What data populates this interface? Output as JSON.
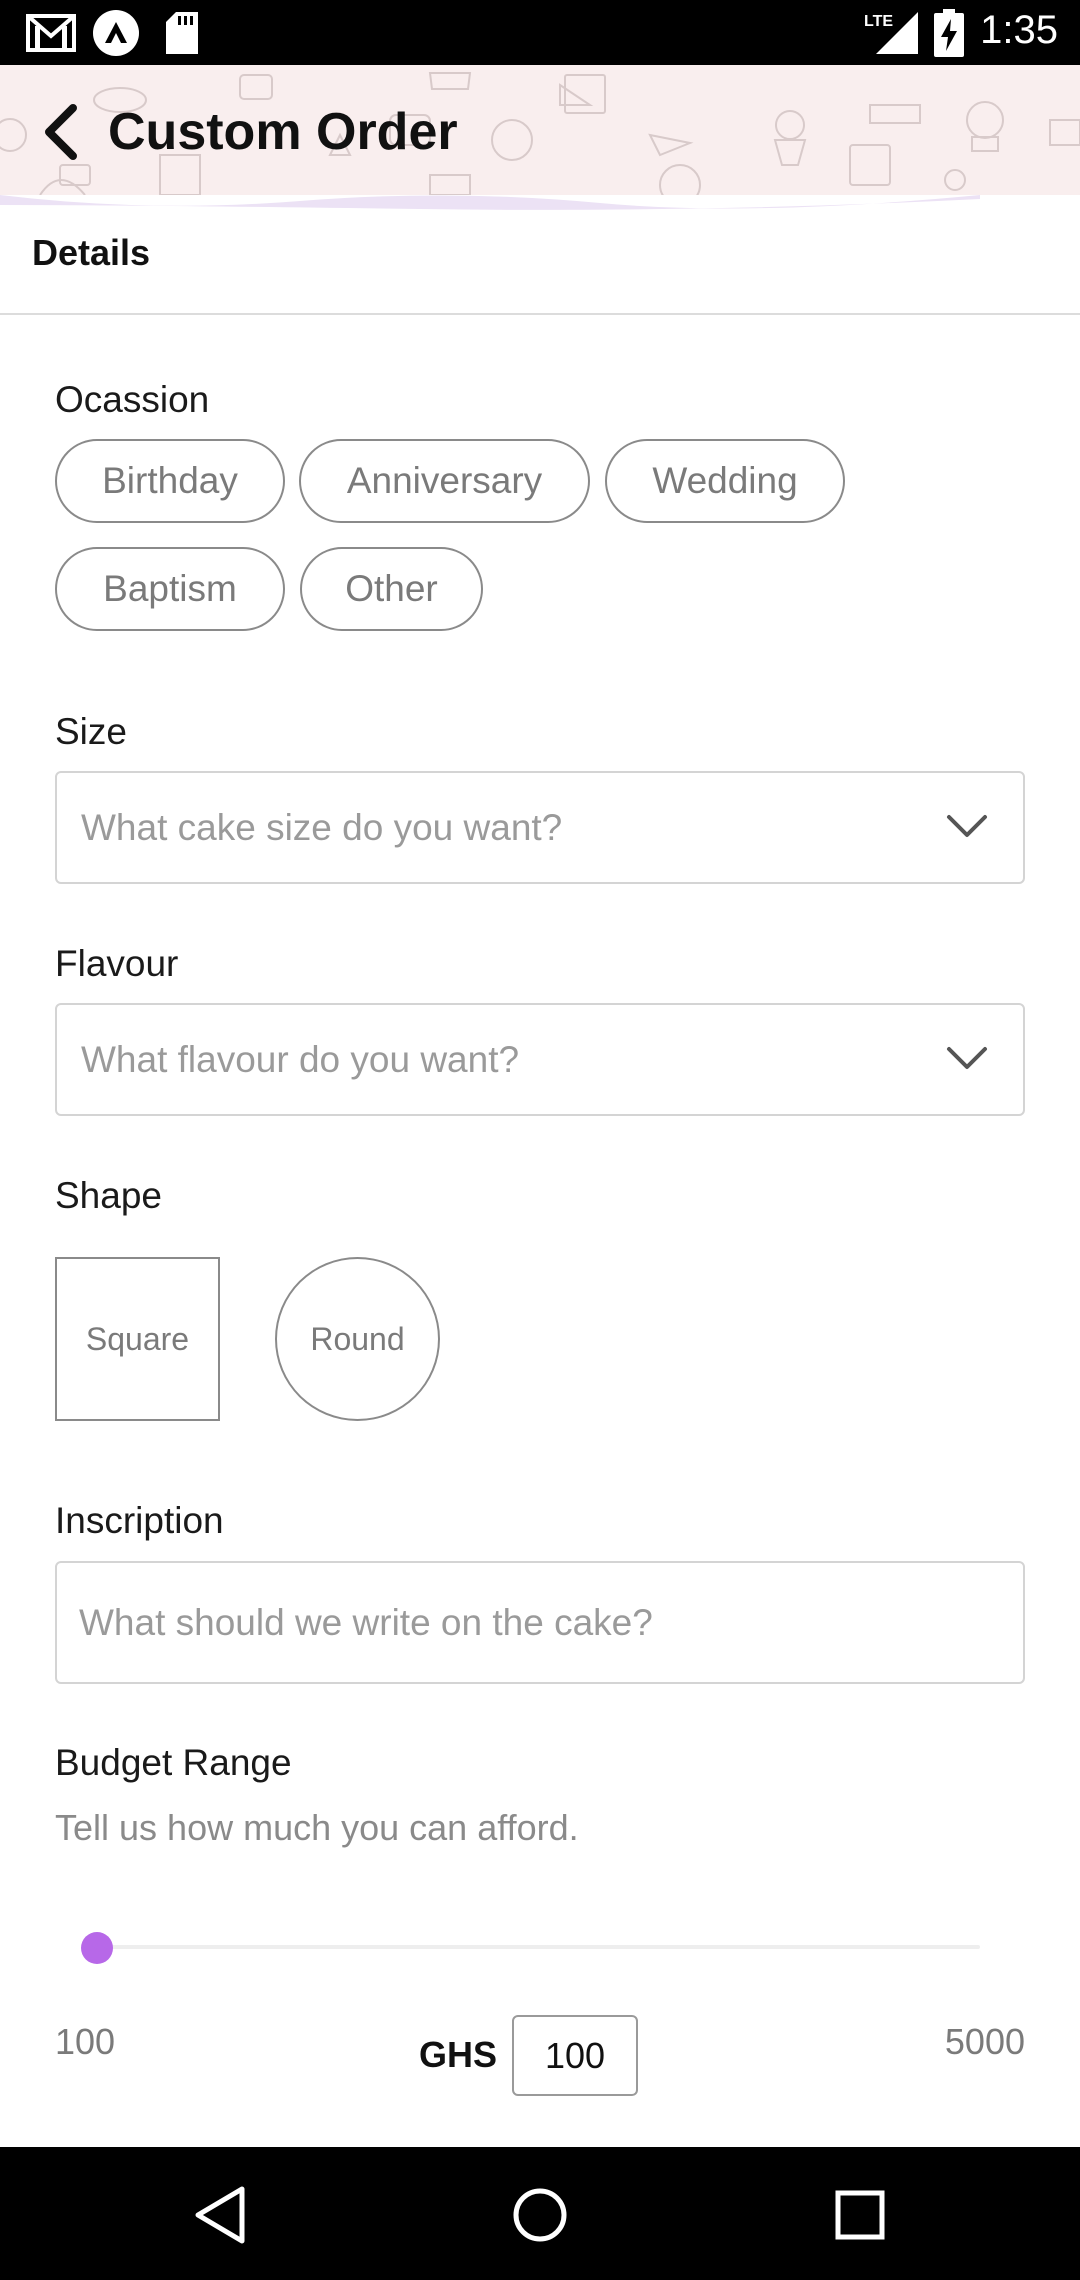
{
  "status_bar": {
    "time": "1:35",
    "icons": [
      "gmail-icon",
      "app-icon",
      "sd-card-icon",
      "lte-signal-icon",
      "battery-charging-icon"
    ],
    "network": "LTE"
  },
  "header": {
    "title": "Custom Order",
    "background_color": "#f9eeee"
  },
  "section": {
    "tab_label": "Details"
  },
  "occasion": {
    "label": "Ocassion",
    "options": [
      "Birthday",
      "Anniversary",
      "Wedding",
      "Baptism",
      "Other"
    ]
  },
  "size": {
    "label": "Size",
    "placeholder": "What cake size do you want?"
  },
  "flavour": {
    "label": "Flavour",
    "placeholder": "What flavour do you want?"
  },
  "shape": {
    "label": "Shape",
    "options": [
      "Square",
      "Round"
    ]
  },
  "inscription": {
    "label": "Inscription",
    "placeholder": "What should we write on the cake?"
  },
  "budget": {
    "label": "Budget Range",
    "hint": "Tell us how much you can afford.",
    "min": "100",
    "max": "5000",
    "currency": "GHS",
    "value": "100",
    "accent_color": "#b768e8"
  }
}
